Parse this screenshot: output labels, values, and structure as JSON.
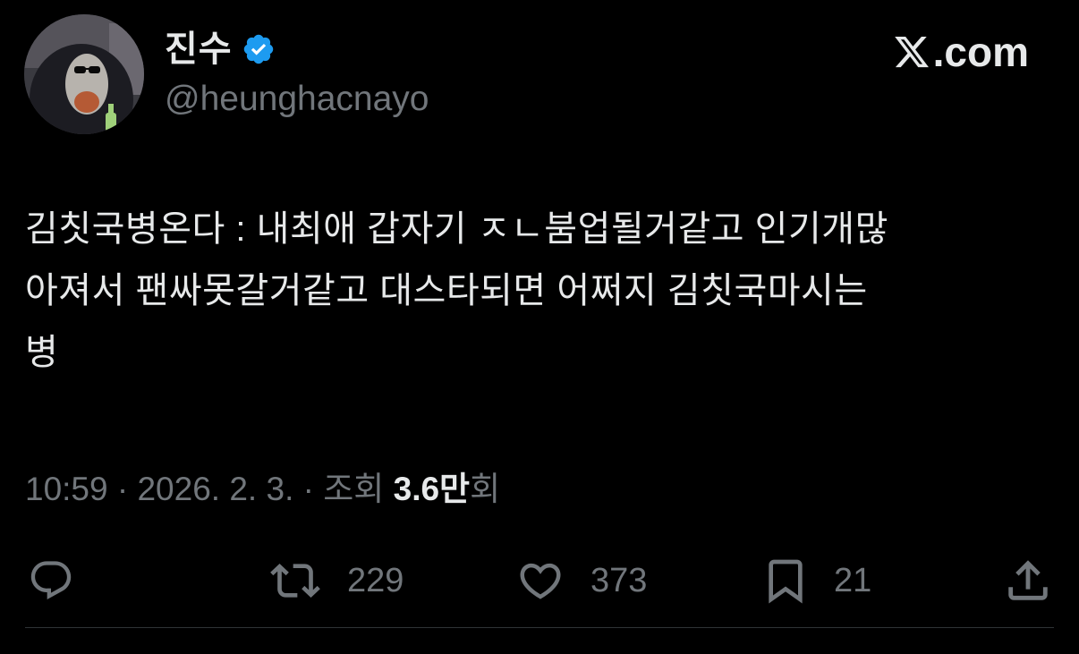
{
  "author": {
    "display_name": "진수",
    "handle": "@heunghacnayo",
    "verified": true,
    "verified_color": "#1d9bf0"
  },
  "brand": {
    "label": ".com",
    "icon": "x-logo-icon"
  },
  "tweet": {
    "lines": [
      "김칫국병온다 : 내최애 갑자기 ㅈㄴ붐업될거같고 인기개많",
      "아져서 팬싸못갈거같고 대스타되면 어쩌지 김칫국마시는",
      "병"
    ]
  },
  "meta": {
    "time": "10:59",
    "date": "2026. 2. 3.",
    "views_label": "조회",
    "views_count": "3.6만",
    "views_suffix": "회",
    "separator": "·"
  },
  "actions": {
    "reply": {
      "icon": "reply-icon",
      "count": ""
    },
    "repost": {
      "icon": "repost-icon",
      "count": "229"
    },
    "like": {
      "icon": "heart-icon",
      "count": "373"
    },
    "bookmark": {
      "icon": "bookmark-icon",
      "count": "21"
    },
    "share": {
      "icon": "share-icon",
      "count": ""
    }
  },
  "colors": {
    "background": "#000000",
    "text_primary": "#e7e9ea",
    "text_secondary": "#71767b",
    "divider": "#2f3336"
  }
}
